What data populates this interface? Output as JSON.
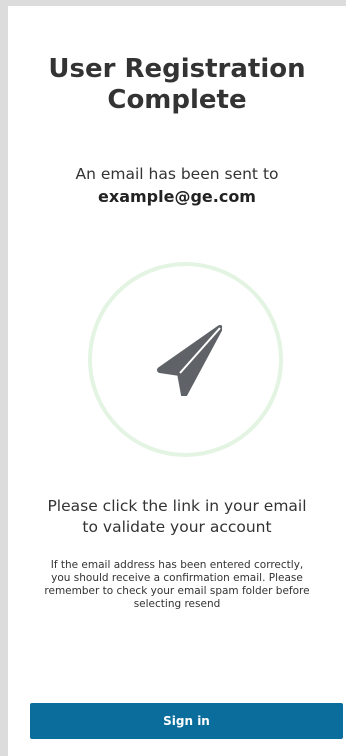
{
  "page": {
    "title_line1": "User Registration",
    "title_line2": "Complete",
    "email_sent_text": "An email has been sent to",
    "email_address": "example@ge.com",
    "validate_line1": "Please click the link in your email",
    "validate_line2": "to validate your account",
    "notice_text": "If the email address has been entered correctly, you should receive a confirmation email. Please remember to check your email spam folder before selecting resend",
    "signin_label": "Sign in"
  },
  "icons": {
    "hero": "paper-plane-icon"
  },
  "colors": {
    "background": "#dcdcdc",
    "card": "#ffffff",
    "text": "#333333",
    "circle_ring": "#e3f4e3",
    "icon": "#5f6368",
    "button": "#0a6d9b",
    "button_text": "#ffffff"
  }
}
